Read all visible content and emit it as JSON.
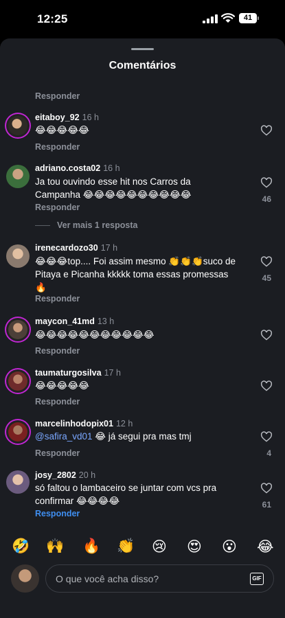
{
  "status_bar": {
    "time": "12:25",
    "battery": "41"
  },
  "sheet": {
    "title": "Comentários"
  },
  "reply_label": "Responder",
  "comments": [
    {
      "user": "eitaboy_92",
      "time": "16 h",
      "text": "😂😂😂😂😂",
      "likes": ""
    },
    {
      "user": "adriano.costa02",
      "time": "16 h",
      "text": "Ja tou ouvindo esse hit nos Carros da Campanha 😂😂😂😂😂😂😂😂😂😂",
      "likes": "46"
    },
    {
      "user": "irenecardozo30",
      "time": "17 h",
      "text": "😂😂😂top.... Foi assim mesmo 👏👏👏suco de Pitaya e Picanha kkkkk toma essas promessas 🔥",
      "likes": "45"
    },
    {
      "user": "maycon_41md",
      "time": "13 h",
      "text": "😂😂😂😂😂😂😂😂😂😂😂",
      "likes": ""
    },
    {
      "user": "taumaturgosilva",
      "time": "17 h",
      "text": "😂😂😂😂😂",
      "likes": ""
    },
    {
      "user": "marcelinhodopix01",
      "time": "12 h",
      "mention": "@safira_vd01",
      "text": " 😂 já segui pra mas tmj",
      "likes": "4"
    },
    {
      "user": "josy_2802",
      "time": "20 h",
      "text": "só faltou o lambaceiro se juntar com vcs pra confirmar 😂😂😂😂",
      "likes": "61"
    }
  ],
  "view_more": "Ver mais 1 resposta",
  "emoji_bar": [
    "🤣",
    "🙌",
    "🔥",
    "👏",
    "😢",
    "😍",
    "😮",
    "😂"
  ],
  "composer": {
    "placeholder": "O que você acha disso?",
    "gif_label": "GIF"
  },
  "colors": {
    "background": "#1b1d22",
    "secondary_text": "#8c9099",
    "link": "#3f8ef0",
    "story_ring": "#c026d3"
  }
}
